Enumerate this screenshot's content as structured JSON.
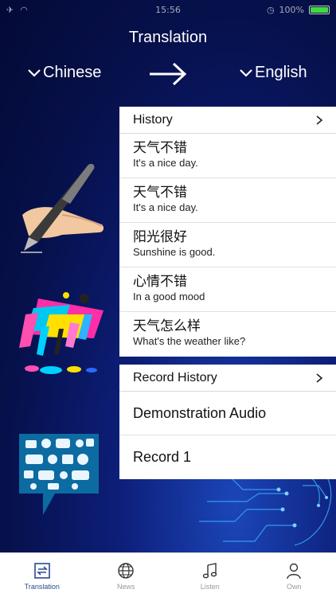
{
  "status_bar": {
    "time": "15:56",
    "battery_percent": "100%"
  },
  "header": {
    "title": "Translation",
    "source_language": "Chinese",
    "target_language": "English"
  },
  "history": {
    "label": "History",
    "items": [
      {
        "zh": "天气不错",
        "en": "It's a nice day."
      },
      {
        "zh": "天气不错",
        "en": "It's a nice day."
      },
      {
        "zh": "阳光很好",
        "en": "Sunshine is good."
      },
      {
        "zh": "心情不错",
        "en": "In a good mood"
      },
      {
        "zh": "天气怎么样",
        "en": "What's the weather like?"
      }
    ]
  },
  "record_history": {
    "label": "Record History",
    "items": [
      "Demonstration Audio",
      "Record 1"
    ]
  },
  "tabbar": {
    "tabs": [
      {
        "label": "Translation",
        "icon": "translate-icon",
        "active": true
      },
      {
        "label": "News",
        "icon": "globe-icon",
        "active": false
      },
      {
        "label": "Listen",
        "icon": "music-note-icon",
        "active": false
      },
      {
        "label": "Own",
        "icon": "person-icon",
        "active": false
      }
    ]
  },
  "colors": {
    "background": "#06104a",
    "active_tab": "#2b4a8f",
    "battery": "#3cdc3c"
  }
}
